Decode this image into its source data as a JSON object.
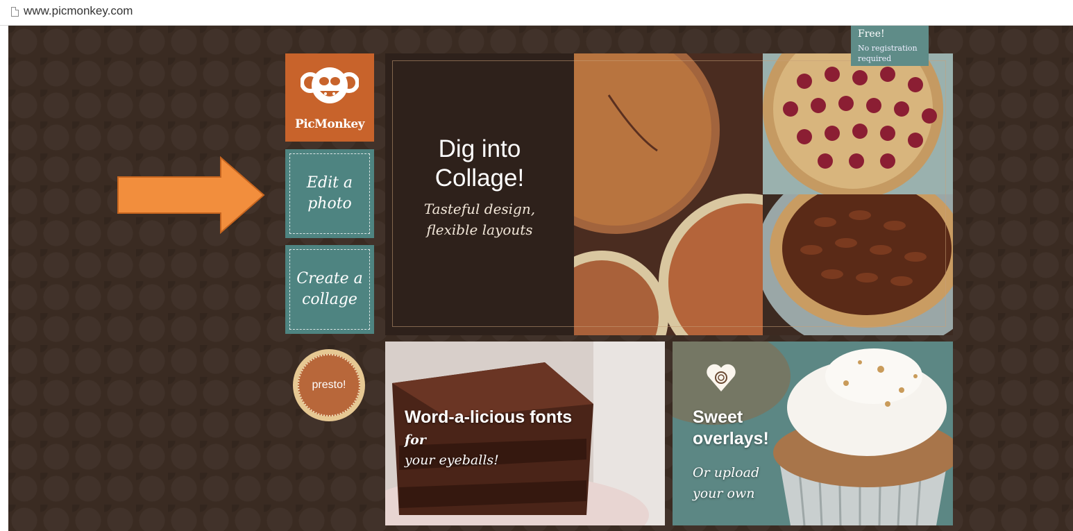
{
  "browser": {
    "url": "www.picmonkey.com"
  },
  "colors": {
    "background": "#3a2b22",
    "logo_orange": "#c8632b",
    "button_teal": "#4e8481",
    "arrow_orange": "#f28e3d",
    "presto_brown": "#b8673a"
  },
  "logo": {
    "name": "PicMonkey",
    "icon": "monkey-face-icon"
  },
  "buttons": {
    "edit_photo": "Edit a photo",
    "create_collage": "Create a collage",
    "presto": "presto!"
  },
  "hero": {
    "title": "Dig into Collage!",
    "subtitle": "Tasteful design, flexible layouts"
  },
  "free_badge": {
    "title": "Free!",
    "subtitle": "No registration required"
  },
  "cards": {
    "fonts": {
      "heading": "Word-a-licious fonts",
      "tail_inline": "for",
      "tail_line": "your eyeballs!"
    },
    "overlays": {
      "heading": "Sweet overlays!",
      "subtitle": "Or upload your own",
      "icon": "heart-icon"
    }
  },
  "decorations": {
    "arrow": "right-arrow-icon"
  }
}
